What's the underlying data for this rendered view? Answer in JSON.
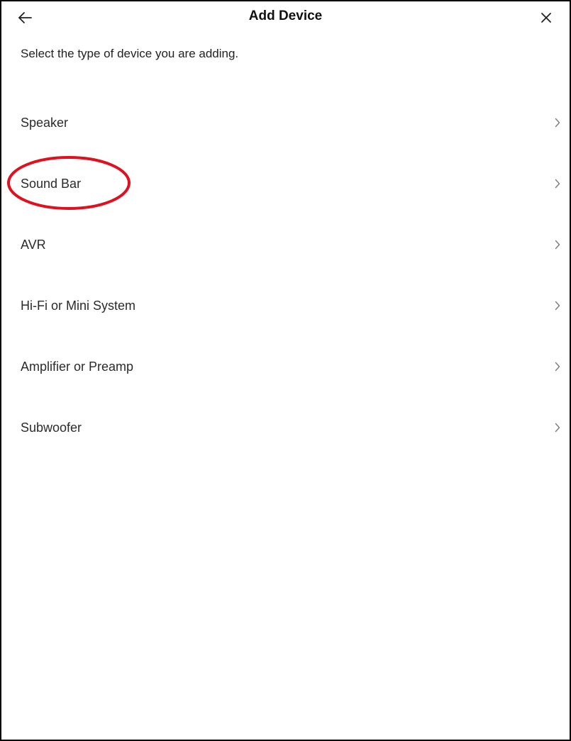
{
  "header": {
    "title": "Add Device",
    "back_icon": "arrow-left-icon",
    "close_icon": "close-icon"
  },
  "subtitle": "Select the type of device you are adding.",
  "device_types": [
    {
      "label": "Speaker",
      "icon": "chevron-right-icon"
    },
    {
      "label": "Sound Bar",
      "icon": "chevron-right-icon"
    },
    {
      "label": "AVR",
      "icon": "chevron-right-icon"
    },
    {
      "label": "Hi-Fi or Mini System",
      "icon": "chevron-right-icon"
    },
    {
      "label": "Amplifier or Preamp",
      "icon": "chevron-right-icon"
    },
    {
      "label": "Subwoofer",
      "icon": "chevron-right-icon"
    }
  ],
  "annotation": {
    "highlighted_item": "Sound Bar",
    "color": "#e0101e"
  },
  "colors": {
    "text": "#2b2b2b",
    "chevron": "#7a7a7a",
    "frame_border": "#000000"
  }
}
